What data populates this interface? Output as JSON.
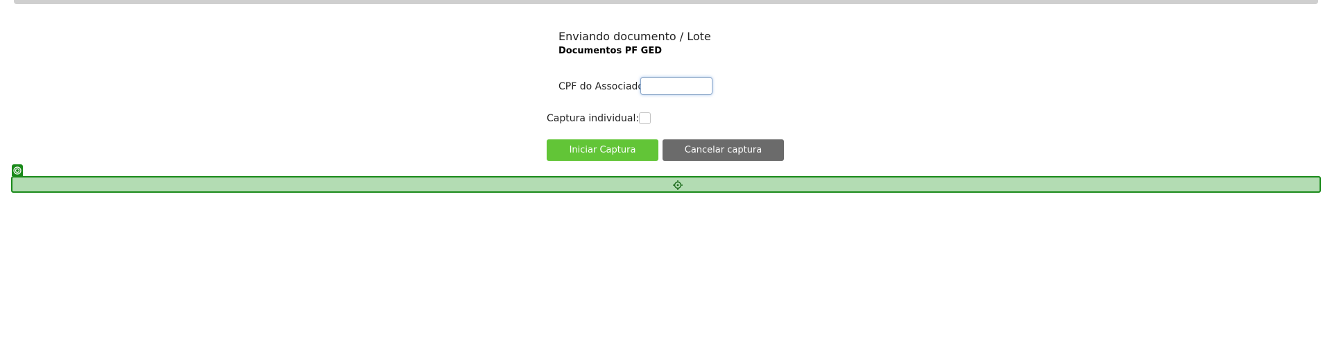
{
  "page": {
    "title": "Enviando documento / Lote",
    "subtitle": "Documentos PF GED"
  },
  "form": {
    "cpf_label": "CPF do Associado:",
    "cpf_value": "",
    "captura_label": "Captura individual:",
    "captura_checked": false
  },
  "buttons": {
    "start_label": "Iniciar Captura",
    "cancel_label": "Cancelar captura"
  },
  "colors": {
    "start_button": "#62c537",
    "cancel_button": "#6b6b6b",
    "strip_fill": "#b3dcb3",
    "strip_border": "#1a8a1a"
  },
  "icons": {
    "strip_tag": "target-icon",
    "strip_center": "crosshair-icon"
  }
}
